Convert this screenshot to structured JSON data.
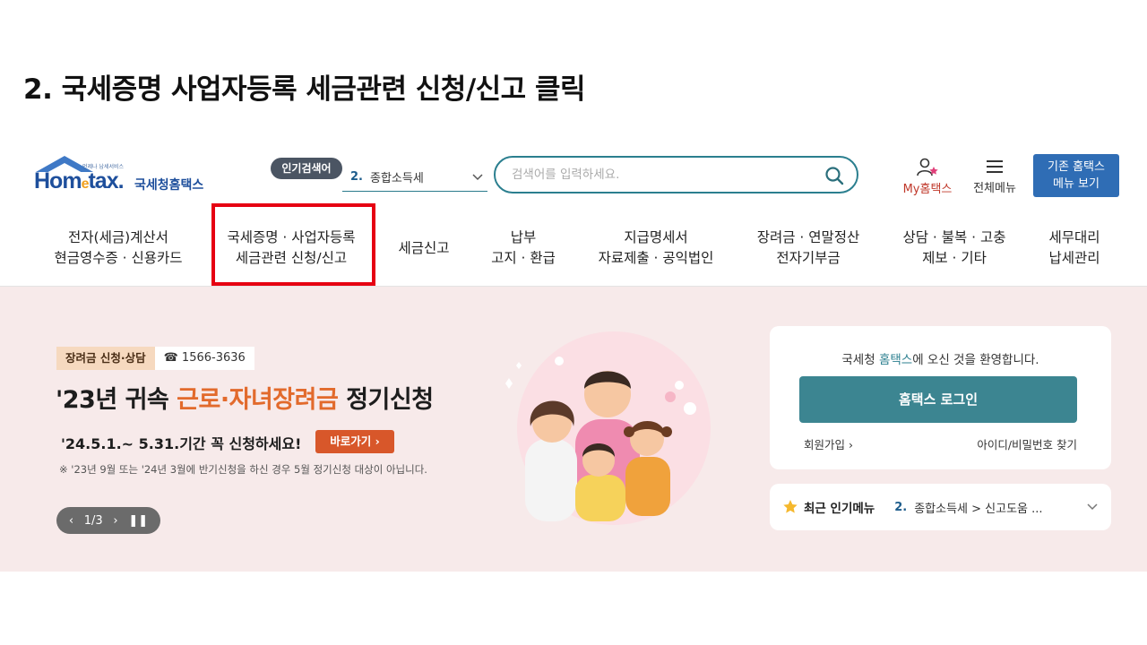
{
  "slide_title": "2. 국세증명 사업자등록 세금관련 신청/신고 클릭",
  "logo": {
    "tagline": "언제나 납세서비스",
    "mark_pre": "Hom",
    "mark_e": "e",
    "mark_post": "tax.",
    "name": "국세청홈택스"
  },
  "header": {
    "popular_badge": "인기검색어",
    "popular_num": "2.",
    "popular_value": "종합소득세",
    "search_placeholder": "검색어를 입력하세요.",
    "my_label": "My홈택스",
    "all_menu_label": "전체메뉴",
    "old_home_line1": "기존 홈택스",
    "old_home_line2": "메뉴 보기"
  },
  "gnb": [
    {
      "line1": "전자(세금)계산서",
      "line2": "현금영수증 · 신용카드"
    },
    {
      "line1": "국세증명 · 사업자등록",
      "line2": "세금관련 신청/신고"
    },
    {
      "line1": "세금신고",
      "line2": ""
    },
    {
      "line1": "납부",
      "line2": "고지 · 환급"
    },
    {
      "line1": "지급명세서",
      "line2": "자료제출 · 공익법인"
    },
    {
      "line1": "장려금 · 연말정산",
      "line2": "전자기부금"
    },
    {
      "line1": "상담 · 불복 · 고충",
      "line2": "제보 · 기타"
    },
    {
      "line1": "세무대리",
      "line2": "납세관리"
    }
  ],
  "promo": {
    "tag": "장려금 신청·상담",
    "phone": "☎ 1566-3636",
    "headline_pre": "'23년 귀속 ",
    "headline_accent": "근로·자녀장려금",
    "headline_post": " 정기신청",
    "period": "'24.5.1.~ 5.31.기간 꼭 신청하세요!",
    "goto_label": "바로가기",
    "note": "※ '23년 9월 또는 '24년 3월에 반기신청을 하신 경우 5월 정기신청 대상이 아닙니다.",
    "pager_text": "1/3"
  },
  "login": {
    "welcome_pre": "국세청 ",
    "welcome_hl": "홈택스",
    "welcome_post": "에 오신 것을 환영합니다.",
    "login_button": "홈택스 로그인",
    "join_link": "회원가입",
    "find_link": "아이디/비밀번호 찾기"
  },
  "recent": {
    "label": "최근 인기메뉴",
    "num": "2.",
    "value": "종합소득세 > 신고도움 ..."
  },
  "colors": {
    "highlight": "#e60012",
    "teal": "#3c8591",
    "accent_orange": "#e26a2c",
    "banner_bg": "#f7eaea"
  }
}
